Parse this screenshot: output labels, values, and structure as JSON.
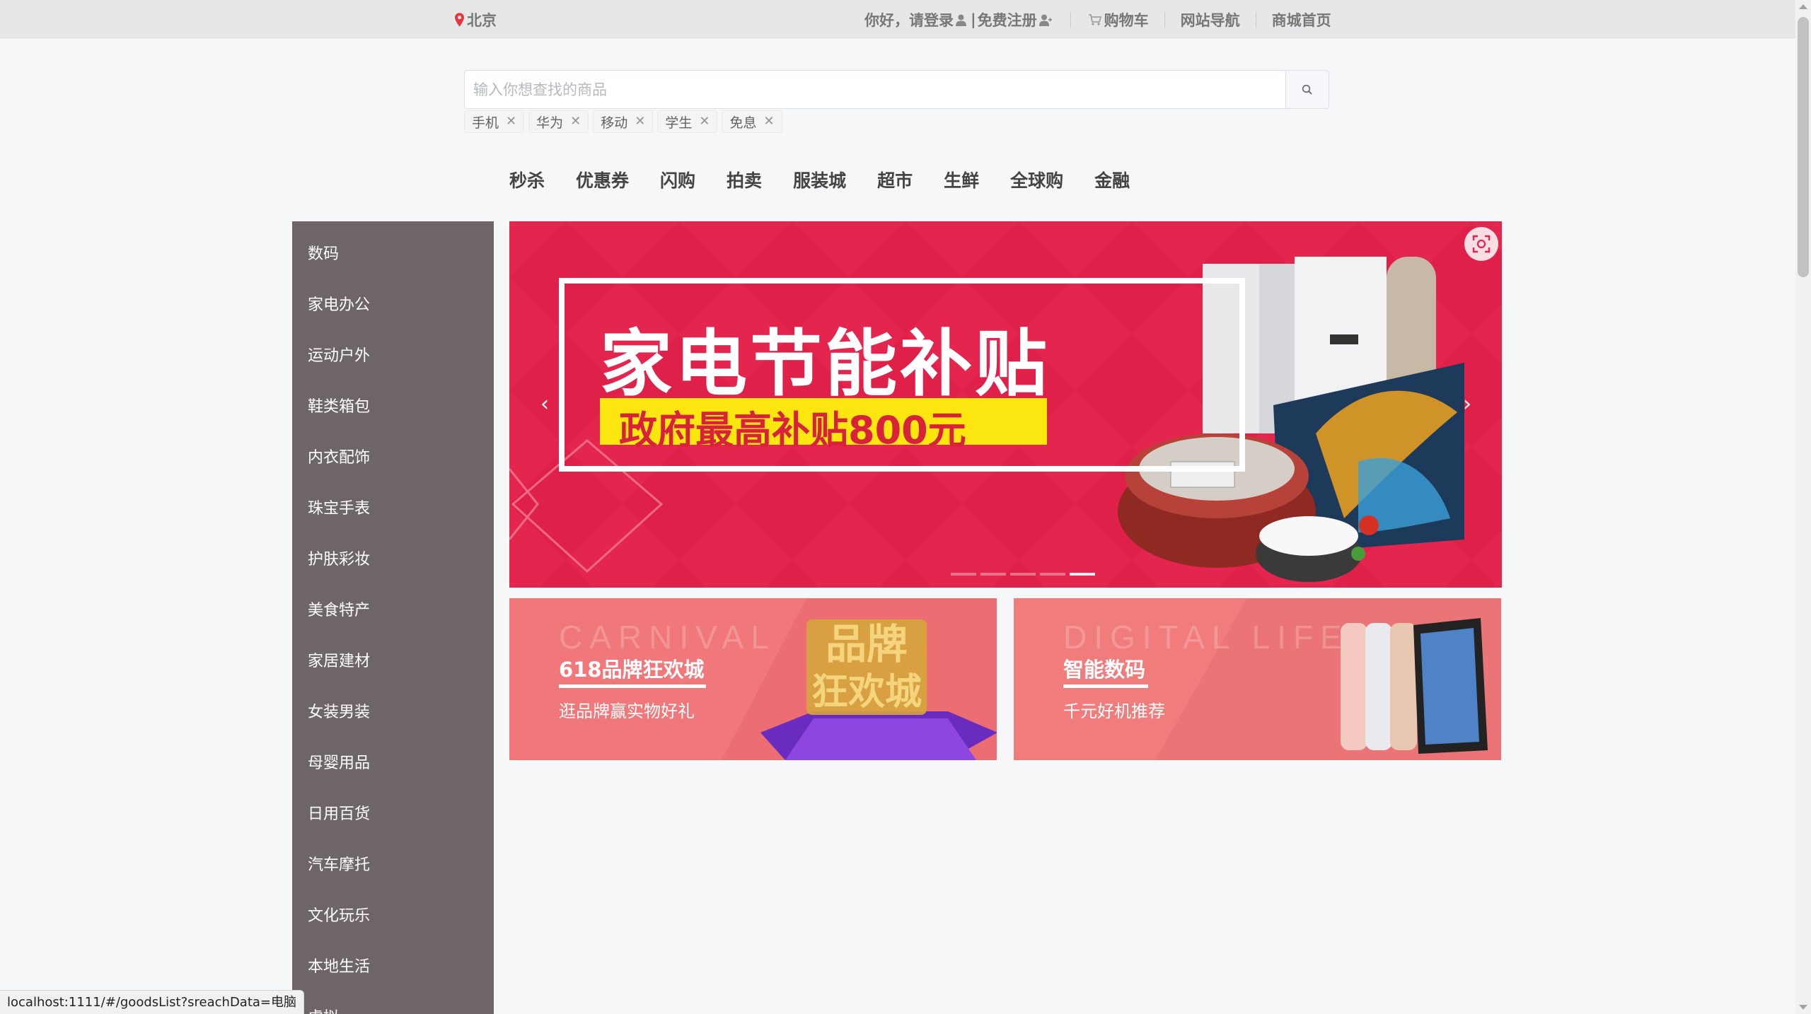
{
  "topbar": {
    "location": "北京",
    "greeting": "你好，请",
    "login": "登录",
    "divider": "|",
    "register": "免费注册",
    "cart": "购物车",
    "site_nav": "网站导航",
    "home": "商城首页"
  },
  "search": {
    "placeholder": "输入你想查找的商品",
    "value": "",
    "tags": [
      "手机",
      "华为",
      "移动",
      "学生",
      "免息"
    ],
    "tag_close": "✕"
  },
  "nav": {
    "items": [
      "秒杀",
      "优惠券",
      "闪购",
      "拍卖",
      "服装城",
      "超市",
      "生鲜",
      "全球购",
      "金融"
    ]
  },
  "sidebar": {
    "categories": [
      "数码",
      "家电办公",
      "运动户外",
      "鞋类箱包",
      "内衣配饰",
      "珠宝手表",
      "护肤彩妆",
      "美食特产",
      "家居建材",
      "女装男装",
      "母婴用品",
      "日用百货",
      "汽车摩托",
      "文化玩乐",
      "本地生活",
      "虚拟"
    ]
  },
  "carousel": {
    "headline": "家电节能补贴",
    "subline": "政府最高补贴800元",
    "prev": "‹",
    "next": "›",
    "slide_count": 5,
    "active_slide": 5,
    "colors": {
      "bg": "#e3254d",
      "accent": "#fbe70f"
    }
  },
  "promos": [
    {
      "ghost": "CARNIVAL",
      "title": "618品牌狂欢城",
      "desc": "逛品牌赢实物好礼",
      "art_text": "品牌狂欢城"
    },
    {
      "ghost": "DIGITAL LIFE",
      "title": "智能数码",
      "desc": "千元好机推荐"
    }
  ],
  "status": {
    "url": "localhost:1111/#/goodsList?sreachData=电脑"
  },
  "icons": {
    "location": "map-pin-icon",
    "user": "user-icon",
    "add_user": "user-plus-icon",
    "cart": "cart-icon",
    "search": "search-icon",
    "scan": "scan-icon"
  }
}
